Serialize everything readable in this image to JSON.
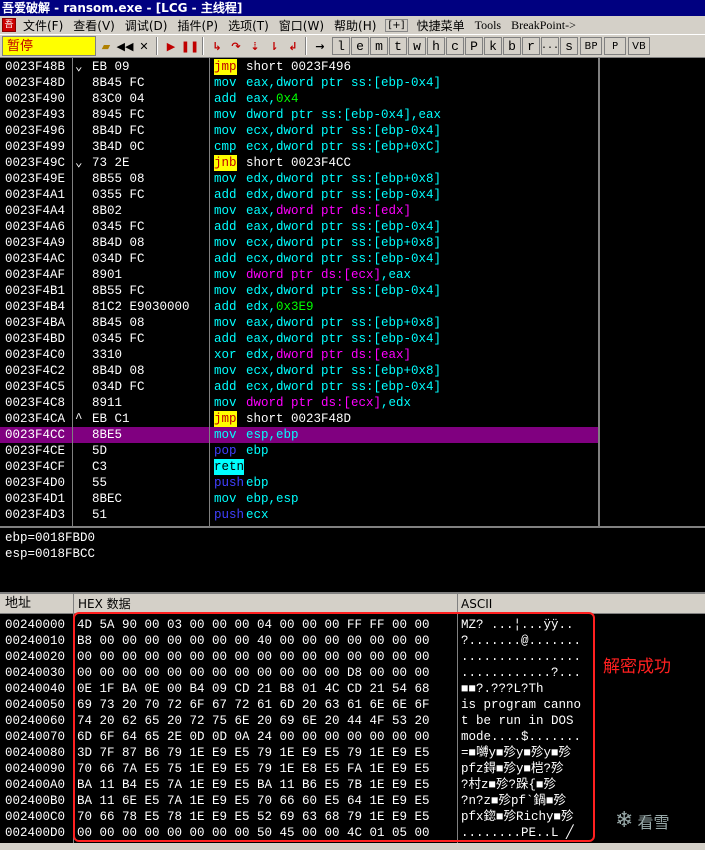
{
  "window": {
    "title": "吾爱破解 - ransom.exe - [LCG - 主线程]"
  },
  "menu": {
    "items": [
      "文件(F)",
      "查看(V)",
      "调试(D)",
      "插件(P)",
      "选项(T)",
      "窗口(W)",
      "帮助(H)"
    ],
    "plus": "[+]",
    "quick": "快捷菜单",
    "tools": "Tools",
    "breakpoint": "BreakPoint->"
  },
  "toolbar": {
    "status": "暂停",
    "letters": [
      "l",
      "e",
      "m",
      "t",
      "w",
      "h",
      "c",
      "P",
      "k",
      "b",
      "r",
      "...",
      "s"
    ],
    "right_buttons": [
      "BP",
      "P",
      "VB"
    ]
  },
  "disasm": [
    {
      "addr": "0023F48B",
      "jm": "⌄",
      "hex": "EB 09",
      "mn": "jmp",
      "op": [
        [
          "short 0023F496",
          "w"
        ]
      ],
      "hl": "y"
    },
    {
      "addr": "0023F48D",
      "jm": "",
      "hex": "8B45 FC",
      "mn": "mov",
      "op": [
        [
          "eax,",
          "c"
        ],
        [
          "dword ptr ss:[ebp-0x4]",
          "c"
        ]
      ],
      "hl": ""
    },
    {
      "addr": "0023F490",
      "jm": "",
      "hex": "83C0 04",
      "mn": "add",
      "op": [
        [
          "eax,",
          "c"
        ],
        [
          "0x4",
          "g"
        ]
      ],
      "hl": ""
    },
    {
      "addr": "0023F493",
      "jm": "",
      "hex": "8945 FC",
      "mn": "mov",
      "op": [
        [
          "dword ptr ss:[ebp-0x4],eax",
          "c"
        ]
      ],
      "hl": ""
    },
    {
      "addr": "0023F496",
      "jm": "",
      "hex": "8B4D FC",
      "mn": "mov",
      "op": [
        [
          "ecx,dword ptr ss:[ebp-0x4]",
          "c"
        ]
      ],
      "hl": ""
    },
    {
      "addr": "0023F499",
      "jm": "",
      "hex": "3B4D 0C",
      "mn": "cmp",
      "op": [
        [
          "ecx,dword ptr ss:[ebp+0xC]",
          "c"
        ]
      ],
      "hl": ""
    },
    {
      "addr": "0023F49C",
      "jm": "⌄",
      "hex": "73 2E",
      "mn": "jnb",
      "op": [
        [
          "short 0023F4CC",
          "w"
        ]
      ],
      "hl": "y"
    },
    {
      "addr": "0023F49E",
      "jm": "",
      "hex": "8B55 08",
      "mn": "mov",
      "op": [
        [
          "edx,dword ptr ss:[ebp+0x8]",
          "c"
        ]
      ],
      "hl": ""
    },
    {
      "addr": "0023F4A1",
      "jm": "",
      "hex": "0355 FC",
      "mn": "add",
      "op": [
        [
          "edx,dword ptr ss:[ebp-0x4]",
          "c"
        ]
      ],
      "hl": ""
    },
    {
      "addr": "0023F4A4",
      "jm": "",
      "hex": "8B02",
      "mn": "mov",
      "op": [
        [
          "eax,",
          "c"
        ],
        [
          "dword ptr ds:[edx]",
          "m"
        ]
      ],
      "hl": ""
    },
    {
      "addr": "0023F4A6",
      "jm": "",
      "hex": "0345 FC",
      "mn": "add",
      "op": [
        [
          "eax,dword ptr ss:[ebp-0x4]",
          "c"
        ]
      ],
      "hl": ""
    },
    {
      "addr": "0023F4A9",
      "jm": "",
      "hex": "8B4D 08",
      "mn": "mov",
      "op": [
        [
          "ecx,dword ptr ss:[ebp+0x8]",
          "c"
        ]
      ],
      "hl": ""
    },
    {
      "addr": "0023F4AC",
      "jm": "",
      "hex": "034D FC",
      "mn": "add",
      "op": [
        [
          "ecx,dword ptr ss:[ebp-0x4]",
          "c"
        ]
      ],
      "hl": ""
    },
    {
      "addr": "0023F4AF",
      "jm": "",
      "hex": "8901",
      "mn": "mov",
      "op": [
        [
          "dword ptr ds:[ecx]",
          "m"
        ],
        [
          ",eax",
          "c"
        ]
      ],
      "hl": ""
    },
    {
      "addr": "0023F4B1",
      "jm": "",
      "hex": "8B55 FC",
      "mn": "mov",
      "op": [
        [
          "edx,dword ptr ss:[ebp-0x4]",
          "c"
        ]
      ],
      "hl": ""
    },
    {
      "addr": "0023F4B4",
      "jm": "",
      "hex": "81C2 E9030000",
      "mn": "add",
      "op": [
        [
          "edx,",
          "c"
        ],
        [
          "0x3E9",
          "g"
        ]
      ],
      "hl": ""
    },
    {
      "addr": "0023F4BA",
      "jm": "",
      "hex": "8B45 08",
      "mn": "mov",
      "op": [
        [
          "eax,dword ptr ss:[ebp+0x8]",
          "c"
        ]
      ],
      "hl": ""
    },
    {
      "addr": "0023F4BD",
      "jm": "",
      "hex": "0345 FC",
      "mn": "add",
      "op": [
        [
          "eax,dword ptr ss:[ebp-0x4]",
          "c"
        ]
      ],
      "hl": ""
    },
    {
      "addr": "0023F4C0",
      "jm": "",
      "hex": "3310",
      "mn": "xor",
      "op": [
        [
          "edx,",
          "c"
        ],
        [
          "dword ptr ds:[eax]",
          "m"
        ]
      ],
      "hl": ""
    },
    {
      "addr": "0023F4C2",
      "jm": "",
      "hex": "8B4D 08",
      "mn": "mov",
      "op": [
        [
          "ecx,dword ptr ss:[ebp+0x8]",
          "c"
        ]
      ],
      "hl": ""
    },
    {
      "addr": "0023F4C5",
      "jm": "",
      "hex": "034D FC",
      "mn": "add",
      "op": [
        [
          "ecx,dword ptr ss:[ebp-0x4]",
          "c"
        ]
      ],
      "hl": ""
    },
    {
      "addr": "0023F4C8",
      "jm": "",
      "hex": "8911",
      "mn": "mov",
      "op": [
        [
          "dword ptr ds:[ecx]",
          "m"
        ],
        [
          ",edx",
          "c"
        ]
      ],
      "hl": ""
    },
    {
      "addr": "0023F4CA",
      "jm": "^",
      "hex": "EB C1",
      "mn": "jmp",
      "op": [
        [
          "short 0023F48D",
          "w"
        ]
      ],
      "hl": "y"
    },
    {
      "addr": "0023F4CC",
      "jm": "",
      "hex": "8BE5",
      "mn": "mov",
      "op": [
        [
          "esp,ebp",
          "c"
        ]
      ],
      "hl": "",
      "sel": true
    },
    {
      "addr": "0023F4CE",
      "jm": "",
      "hex": "5D",
      "mn": "pop",
      "op": [
        [
          "ebp",
          "c"
        ]
      ],
      "hl": "b"
    },
    {
      "addr": "0023F4CF",
      "jm": "",
      "hex": "C3",
      "mn": "retn",
      "op": [],
      "hl": "c"
    },
    {
      "addr": "0023F4D0",
      "jm": "",
      "hex": "55",
      "mn": "push",
      "op": [
        [
          "ebp",
          "c"
        ]
      ],
      "hl": "b"
    },
    {
      "addr": "0023F4D1",
      "jm": "",
      "hex": "8BEC",
      "mn": "mov",
      "op": [
        [
          "ebp,esp",
          "c"
        ]
      ],
      "hl": ""
    },
    {
      "addr": "0023F4D3",
      "jm": "",
      "hex": "51",
      "mn": "push",
      "op": [
        [
          "ecx",
          "c"
        ]
      ],
      "hl": "b"
    }
  ],
  "registers": [
    "ebp=0018FBD0",
    "esp=0018FBCC"
  ],
  "dump_header": {
    "address": "地址",
    "hex": "HEX 数据",
    "ascii": "ASCII"
  },
  "dump": [
    {
      "a": "00240000",
      "h": "4D 5A 90 00|03 00 00 00|04 00 00 00|FF FF 00 00",
      "s": "MZ? ...¦...ÿÿ.."
    },
    {
      "a": "00240010",
      "h": "B8 00 00 00|00 00 00 00|40 00 00 00|00 00 00 00",
      "s": "?.......@......."
    },
    {
      "a": "00240020",
      "h": "00 00 00 00|00 00 00 00|00 00 00 00|00 00 00 00",
      "s": "................"
    },
    {
      "a": "00240030",
      "h": "00 00 00 00|00 00 00 00|00 00 00 00|D8 00 00 00",
      "s": "............?..."
    },
    {
      "a": "00240040",
      "h": "0E 1F BA 0E|00 B4 09 CD|21 B8 01 4C|CD 21 54 68",
      "s": "■■?.???L?Th"
    },
    {
      "a": "00240050",
      "h": "69 73 20 70|72 6F 67 72|61 6D 20 63|61 6E 6E 6F",
      "s": "is program canno"
    },
    {
      "a": "00240060",
      "h": "74 20 62 65|20 72 75 6E|20 69 6E 20|44 4F 53 20",
      "s": "t be run in DOS "
    },
    {
      "a": "00240070",
      "h": "6D 6F 64 65|2E 0D 0D 0A|24 00 00 00|00 00 00 00",
      "s": "mode....$......."
    },
    {
      "a": "00240080",
      "h": "3D 7F 87 B6|79 1E E9 E5|79 1E E9 E5|79 1E E9 E5",
      "s": "=■嚩y■殄y■殄y■殄"
    },
    {
      "a": "00240090",
      "h": "70 66 7A E5|75 1E E9 E5|79 1E E8 E5|FA 1E E9 E5",
      "s": "pfz鍀■殄y■桤?殄"
    },
    {
      "a": "002400A0",
      "h": "BA 11 B4 E5|7A 1E E9 E5|BA 11 B6 E5|7B 1E E9 E5",
      "s": "?村z■殄?跺{■殄"
    },
    {
      "a": "002400B0",
      "h": "BA 11 6E E5|7A 1E E9 E5|70 66 60 E5|64 1E E9 E5",
      "s": "?n?z■殄pf`鍋■殄"
    },
    {
      "a": "002400C0",
      "h": "70 66 78 E5|78 1E E9 E5|52 69 63 68|79 1E E9 E5",
      "s": "pfx鍃■殄Richy■殄"
    },
    {
      "a": "002400D0",
      "h": "00 00 00 00|00 00 00 00|50 45 00 00|4C 01 05 00",
      "s": "........PE..L ╱"
    }
  ],
  "annotation": "解密成功",
  "watermark": "看雪",
  "colors": {
    "highlight_box": "#ff2020",
    "selected_row": "#800080",
    "status_bg": "#ffff00"
  }
}
